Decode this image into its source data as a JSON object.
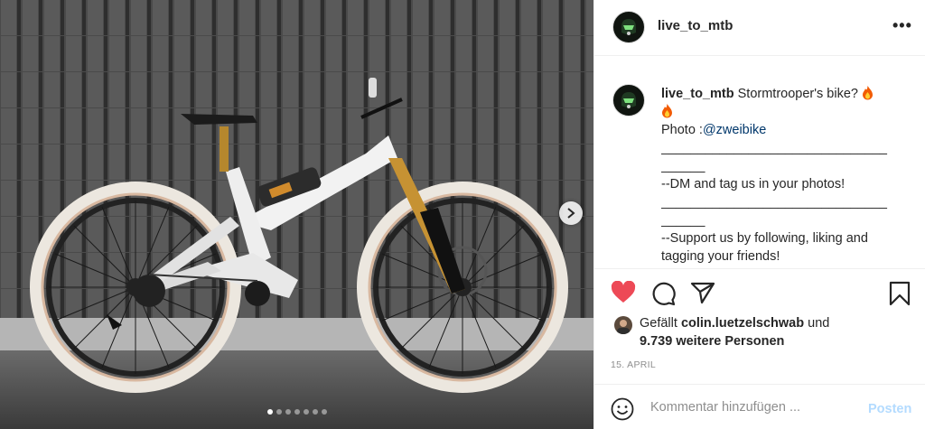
{
  "post": {
    "username": "live_to_mtb",
    "more_label": "•••",
    "caption": {
      "username": "live_to_mtb",
      "line1": "Stormtrooper's bike? ",
      "photo_prefix": "Photo :",
      "photo_mention": "@zweibike",
      "sep1a": "_______________________________",
      "sep1b": "______",
      "dm_line": "--DM and tag us in your photos!",
      "sep2a": "_______________________________",
      "sep2b": "______",
      "support_line1": "--Support us by following, liking and",
      "support_line2": "tagging your friends!"
    },
    "likes": {
      "prefix": "Gefällt ",
      "liker": "colin.luetzelschwab",
      "suffix": " und",
      "others": "9.739 weitere Personen"
    },
    "date": "15. APRIL",
    "comment": {
      "placeholder": "Kommentar hinzufügen ...",
      "post_label": "Posten"
    }
  },
  "carousel": {
    "count": 7,
    "active_index": 0
  },
  "icons": {
    "like": "heart-icon",
    "comment": "comment-icon",
    "share": "paper-plane-icon",
    "save": "bookmark-icon",
    "next": "chevron-right-icon",
    "emoji": "smiley-icon",
    "flame": "fire-emoji-icon"
  },
  "colors": {
    "like_red": "#ed4956",
    "post_disabled": "#b3dbff",
    "mention": "#00376b"
  }
}
